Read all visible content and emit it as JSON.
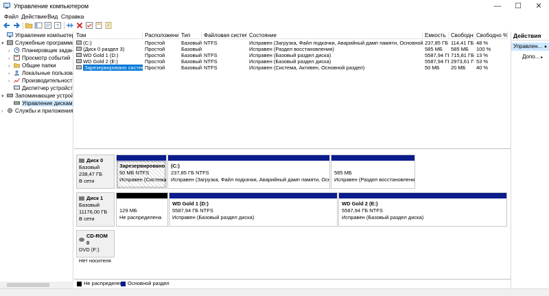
{
  "window": {
    "title": "Управление компьютером",
    "controls": {
      "minimize": "—",
      "maximize": "☐",
      "close": "✕"
    }
  },
  "menu": [
    "Файл",
    "Действие",
    "Вид",
    "Справка"
  ],
  "toolbar_icons": [
    "back-icon",
    "forward-icon",
    "folder-icon",
    "console-tree-icon",
    "properties-icon",
    "help-icon",
    "connect-icon",
    "delete-icon",
    "check-icon",
    "open-icon",
    "wizard-icon"
  ],
  "tree": [
    {
      "label": "Управление компьютером (л",
      "arrow": "",
      "level": 0,
      "icon": "computer-icon"
    },
    {
      "label": "Служебные программы",
      "arrow": "▾",
      "level": 1,
      "icon": "tools-icon"
    },
    {
      "label": "Планировщик заданий",
      "arrow": "›",
      "level": 2,
      "icon": "scheduler-icon"
    },
    {
      "label": "Просмотр событий",
      "arrow": "›",
      "level": 2,
      "icon": "event-viewer-icon"
    },
    {
      "label": "Общие папки",
      "arrow": "›",
      "level": 2,
      "icon": "shared-folder-icon"
    },
    {
      "label": "Локальные пользовате",
      "arrow": "›",
      "level": 2,
      "icon": "users-icon"
    },
    {
      "label": "Производительность",
      "arrow": "›",
      "level": 2,
      "icon": "performance-icon"
    },
    {
      "label": "Диспетчер устройств",
      "arrow": "",
      "level": 2,
      "icon": "device-manager-icon"
    },
    {
      "label": "Запоминающие устройст",
      "arrow": "▾",
      "level": 1,
      "icon": "storage-icon"
    },
    {
      "label": "Управление дисками",
      "arrow": "",
      "level": 2,
      "icon": "disk-management-icon",
      "selected": true
    },
    {
      "label": "Службы и приложения",
      "arrow": "›",
      "level": 1,
      "icon": "services-icon"
    }
  ],
  "volume_table": {
    "columns": [
      "Том",
      "Расположение",
      "Тип",
      "Файловая система",
      "Состояние",
      "Емкость",
      "Свободно",
      "Свободно %"
    ],
    "rows": [
      [
        "(C:)",
        "Простой",
        "Базовый",
        "NTFS",
        "Исправен (Загрузка, Файл подкачки, Аварийный дамп памяти, Основной раздел)",
        "237,85 ГБ",
        "114,41 ГБ",
        "48 %"
      ],
      [
        "(Диск 0 раздел 3)",
        "Простой",
        "Базовый",
        "",
        "Исправен (Раздел восстановления)",
        "585 МБ",
        "585 МБ",
        "100 %"
      ],
      [
        "WD Gold 1 (D:)",
        "Простой",
        "Базовый",
        "NTFS",
        "Исправен (Базовый раздел диска)",
        "5587,94 ГБ",
        "715,81 ГБ",
        "13 %"
      ],
      [
        "WD Gold 2 (E:)",
        "Простой",
        "Базовый",
        "NTFS",
        "Исправен (Базовый раздел диска)",
        "5587,94 ГБ",
        "2973,61 ГБ",
        "53 %"
      ],
      [
        "Зарезервировано системой",
        "Простой",
        "Базовый",
        "NTFS",
        "Исправен (Система, Активен, Основной раздел)",
        "50 МБ",
        "20 МБ",
        "40 %"
      ]
    ]
  },
  "actions": {
    "header": "Действия",
    "group": "Управлен...",
    "more": "Допо..."
  },
  "disks": [
    {
      "name": "Диск 0",
      "type": "Базовый",
      "size": "238,47 ГБ",
      "status": "В сети",
      "partitions": [
        {
          "name": "Зарезервировано си",
          "size": "50 МБ NTFS",
          "status": "Исправен (Система, А"
        },
        {
          "name": "(C:)",
          "size": "237,85 ГБ NTFS",
          "status": "Исправен (Загрузка, Файл подкачки, Аварийный дамп памяти, Основной р"
        },
        {
          "name": "",
          "size": "585 МБ",
          "status": "Исправен (Раздел восстановления)"
        }
      ]
    },
    {
      "name": "Диск 1",
      "type": "Базовый",
      "size": "11176,00 ГБ",
      "status": "В сети",
      "partitions": [
        {
          "name": "",
          "size": "129 МБ",
          "status": "Не распределена"
        },
        {
          "name": "WD Gold 1  (D:)",
          "size": "5587,94 ГБ NTFS",
          "status": "Исправен (Базовый раздел диска)"
        },
        {
          "name": "WD Gold 2  (E:)",
          "size": "5587,94 ГБ NTFS",
          "status": "Исправен (Базовый раздел диска)"
        }
      ]
    },
    {
      "name": "CD-ROM 0",
      "type": "DVD (F:)",
      "size": "",
      "status": "Нет носителя",
      "partitions": []
    }
  ],
  "legend": [
    {
      "label": "Не распределена",
      "color": "#000000"
    },
    {
      "label": "Основной раздел",
      "color": "#0b1c8c"
    }
  ],
  "colors": {
    "primary_partition": "#0b1c8c",
    "unallocated": "#000000",
    "selection": "#0078d7",
    "tree_selection": "#cde8ff"
  }
}
